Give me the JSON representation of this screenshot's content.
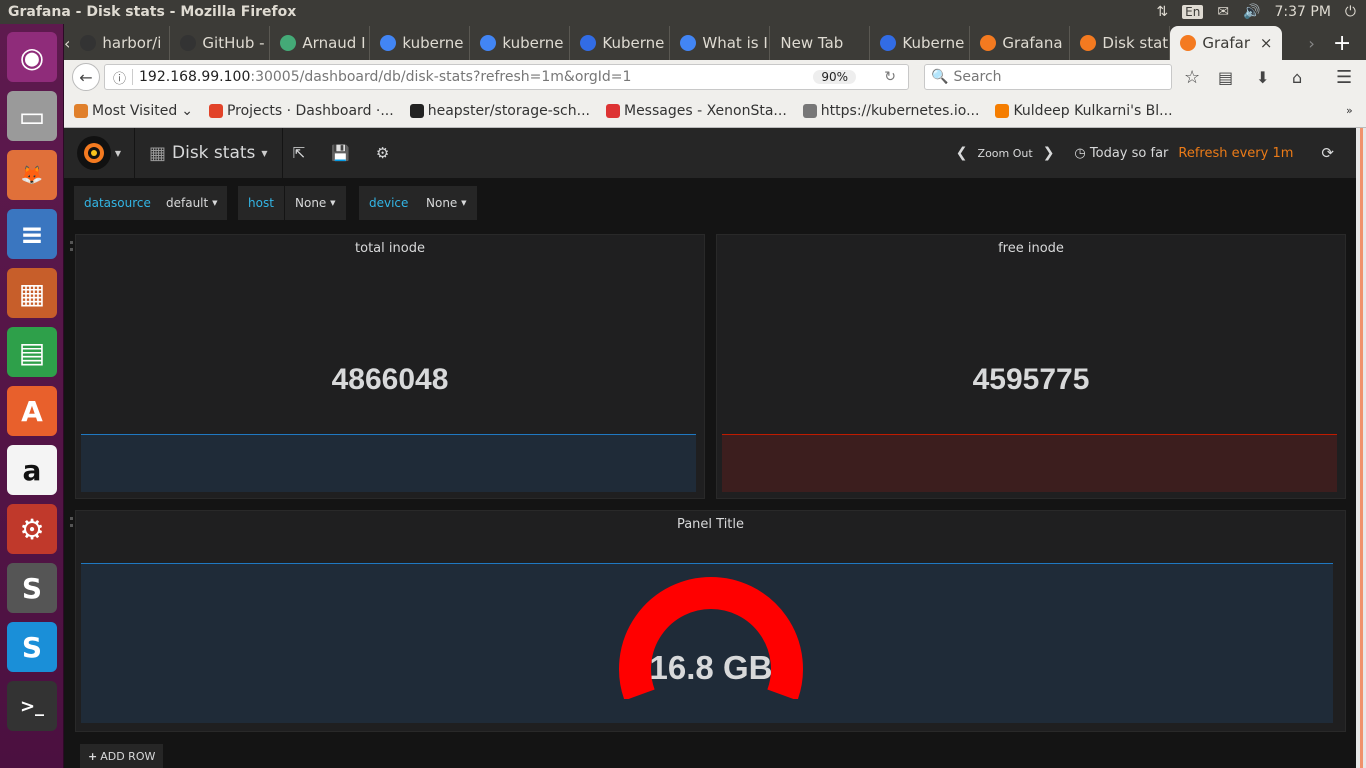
{
  "os_topbar": {
    "window_title": "Grafana - Disk stats - Mozilla Firefox",
    "keyboard_layout": "En",
    "time": "7:37 PM"
  },
  "launcher": {
    "apps": [
      {
        "name": "ubuntu-dash",
        "color": "#8f2c7a",
        "glyph": "◉"
      },
      {
        "name": "files",
        "color": "#9a9a9a",
        "glyph": "▭"
      },
      {
        "name": "firefox",
        "color": "#e0703a",
        "glyph": "🦊"
      },
      {
        "name": "libreoffice-writer",
        "color": "#3a76c0",
        "glyph": "≡"
      },
      {
        "name": "libreoffice-impress",
        "color": "#c75e2a",
        "glyph": "▦"
      },
      {
        "name": "libreoffice-calc",
        "color": "#2ea04a",
        "glyph": "▤"
      },
      {
        "name": "software-center",
        "color": "#e8602c",
        "glyph": "A"
      },
      {
        "name": "amazon",
        "color": "#f4f4f4",
        "glyph": "a"
      },
      {
        "name": "system-settings",
        "color": "#c0392b",
        "glyph": "⚙"
      },
      {
        "name": "sublime-text",
        "color": "#555",
        "glyph": "S"
      },
      {
        "name": "skype",
        "color": "#1a8fd8",
        "glyph": "S"
      },
      {
        "name": "terminal",
        "color": "#333",
        "glyph": ">_"
      }
    ]
  },
  "browser": {
    "tabs": [
      {
        "label": "harbor/i",
        "icon": "github-icon",
        "color": "#333"
      },
      {
        "label": "GitHub -",
        "icon": "github-icon",
        "color": "#333"
      },
      {
        "label": "Arnaud I",
        "icon": "site-icon",
        "color": "#4a7"
      },
      {
        "label": "kuberne",
        "icon": "google-icon",
        "color": "#4285f4"
      },
      {
        "label": "kuberne",
        "icon": "google-icon",
        "color": "#4285f4"
      },
      {
        "label": "Kuberne",
        "icon": "kubernetes-icon",
        "color": "#326ce5"
      },
      {
        "label": "What is I",
        "icon": "docs-icon",
        "color": "#4285f4"
      },
      {
        "label": "New Tab",
        "icon": "",
        "color": ""
      },
      {
        "label": "Kuberne",
        "icon": "kubernetes-icon",
        "color": "#326ce5"
      },
      {
        "label": "Grafana",
        "icon": "grafana-icon",
        "color": "#f47a20"
      },
      {
        "label": "Disk stat",
        "icon": "grafana-icon",
        "color": "#f47a20"
      },
      {
        "label": "Grafar",
        "icon": "grafana-icon",
        "color": "#f47a20",
        "active": true
      }
    ],
    "url_host": "192.168.99.100",
    "url_rest": ":30005/dashboard/db/disk-stats?refresh=1m&orgId=1",
    "zoom": "90%",
    "search_placeholder": "Search",
    "bookmarks": [
      {
        "label": "Most Visited",
        "icon": "folder-icon",
        "color": "#e0802c"
      },
      {
        "label": "Projects · Dashboard ·...",
        "icon": "gitlab-icon",
        "color": "#e24329"
      },
      {
        "label": "heapster/storage-sch...",
        "icon": "github-icon",
        "color": "#222"
      },
      {
        "label": "Messages - XenonSta...",
        "icon": "chat-icon",
        "color": "#d33"
      },
      {
        "label": "https://kubernetes.io...",
        "icon": "globe-icon",
        "color": "#777"
      },
      {
        "label": "Kuldeep Kulkarni's Bl...",
        "icon": "blogger-icon",
        "color": "#f57d00"
      }
    ]
  },
  "grafana": {
    "dashboard_title": "Disk stats",
    "zoom_out": "Zoom Out",
    "time_range": "Today so far",
    "refresh": "Refresh every 1m",
    "accent": "#eb7b18",
    "variables": [
      {
        "label": "datasource",
        "value": "default"
      },
      {
        "label": "host",
        "value": "None"
      },
      {
        "label": "device",
        "value": "None"
      }
    ],
    "panels": [
      {
        "title": "total inode",
        "value": "4866048",
        "spark_color": "#1f78c1",
        "spark_fill": "#1f2b38"
      },
      {
        "title": "free inode",
        "value": "4595775",
        "spark_color": "#bf1b00",
        "spark_fill": "#3c1e1e"
      },
      {
        "title": "Panel Title",
        "value": "16.8 GB",
        "gauge_color": "#ff0000",
        "gauge_fraction": 1.0
      }
    ],
    "add_row": "ADD ROW"
  }
}
